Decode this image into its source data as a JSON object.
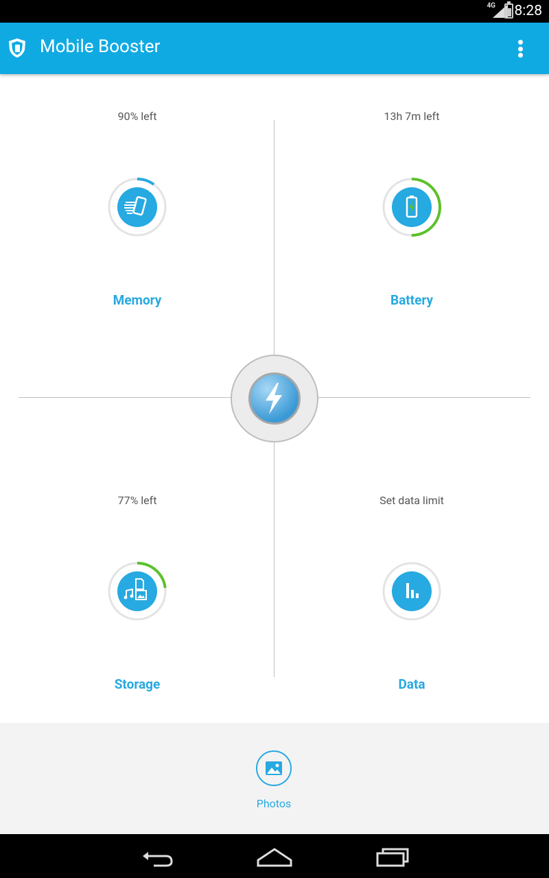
{
  "status_bar": {
    "time": "8:28",
    "network": "4G",
    "icons": [
      "signal-icon",
      "battery-icon"
    ]
  },
  "app_bar": {
    "title": "Mobile Booster",
    "logo_icon": "shield-logo-icon",
    "menu_icon": "overflow-menu-icon"
  },
  "quadrants": {
    "memory": {
      "status": "90% left",
      "label": "Memory",
      "icon": "phone-clean-icon",
      "progress": 0.1,
      "arc_color": "#27a9e1"
    },
    "battery": {
      "status": "13h 7m left",
      "label": "Battery",
      "icon": "battery-charge-icon",
      "progress": 0.5,
      "arc_color": "#5cc02a"
    },
    "storage": {
      "status": "77% left",
      "label": "Storage",
      "icon": "files-icon",
      "progress": 0.23,
      "arc_color": "#5cc02a"
    },
    "data": {
      "status": "Set data limit",
      "label": "Data",
      "icon": "bar-chart-icon",
      "progress": 0,
      "arc_color": "#27a9e1"
    }
  },
  "boost": {
    "icon": "lightning-icon"
  },
  "bottom": {
    "photos": {
      "label": "Photos",
      "icon": "photo-icon"
    }
  },
  "nav_bar": {
    "buttons": [
      "back-icon",
      "home-icon",
      "recents-icon"
    ]
  },
  "colors": {
    "accent": "#10aae3",
    "icon_blue": "#27a9e1",
    "green": "#5cc02a"
  }
}
